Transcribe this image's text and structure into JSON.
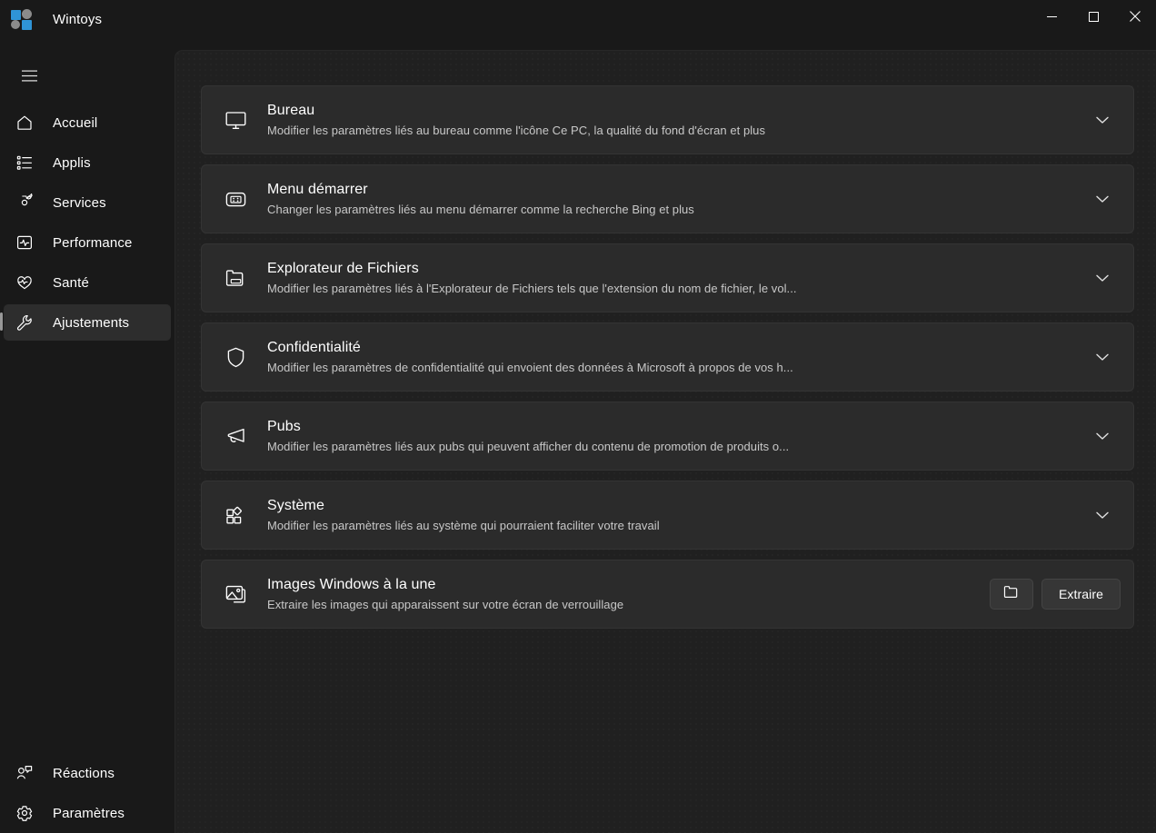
{
  "window": {
    "app_title": "Wintoys",
    "controls": {
      "minimize_label": "Minimize",
      "maximize_label": "Maximize",
      "close_label": "Close"
    }
  },
  "sidebar": {
    "menu_button_label": "Navigation",
    "items": [
      {
        "label": "Accueil",
        "icon": "home-icon",
        "active": false
      },
      {
        "label": "Applis",
        "icon": "apps-list-icon",
        "active": false
      },
      {
        "label": "Services",
        "icon": "gear-cog-icon",
        "active": false
      },
      {
        "label": "Performance",
        "icon": "pulse-chart-icon",
        "active": false
      },
      {
        "label": "Santé",
        "icon": "heart-pulse-icon",
        "active": false
      },
      {
        "label": "Ajustements",
        "icon": "wrench-icon",
        "active": true
      }
    ],
    "bottom_items": [
      {
        "label": "Réactions",
        "icon": "feedback-icon"
      },
      {
        "label": "Paramètres",
        "icon": "settings-gear-icon"
      }
    ]
  },
  "main": {
    "cards": [
      {
        "title": "Bureau",
        "description": "Modifier les paramètres liés au bureau comme l'icône Ce PC, la qualité du fond d'écran et plus",
        "icon": "monitor-icon",
        "expander": "chevron-down-icon"
      },
      {
        "title": "Menu démarrer",
        "description": "Changer les paramètres liés au menu démarrer comme la recherche Bing et plus",
        "icon": "start-menu-icon",
        "expander": "chevron-down-icon"
      },
      {
        "title": "Explorateur de Fichiers",
        "description": "Modifier les paramètres liés à l'Explorateur de Fichiers tels que l'extension du nom de fichier, le vol...",
        "icon": "folder-icon",
        "expander": "chevron-down-icon"
      },
      {
        "title": "Confidentialité",
        "description": "Modifier les paramètres de confidentialité qui envoient des données à Microsoft à propos de vos h...",
        "icon": "shield-icon",
        "expander": "chevron-down-icon"
      },
      {
        "title": "Pubs",
        "description": "Modifier les paramètres liés aux pubs qui peuvent afficher du contenu de promotion de produits o...",
        "icon": "megaphone-icon",
        "expander": "chevron-down-icon"
      },
      {
        "title": "Système",
        "description": "Modifier les paramètres liés au système qui pourraient faciliter votre travail",
        "icon": "system-grid-icon",
        "expander": "chevron-down-icon"
      }
    ],
    "spotlight_card": {
      "title": "Images Windows à la une",
      "description": "Extraire les images qui apparaissent sur votre écran de verrouillage",
      "icon": "picture-icon",
      "folder_button_icon": "folder-open-icon",
      "extract_button_label": "Extraire"
    }
  },
  "colors": {
    "window_background": "#191919",
    "content_background": "#202020",
    "card_background": "#2b2b2b",
    "button_background": "#363636",
    "active_nav_background": "#2d2d2d",
    "accent_logo_blue": "#2f94d6",
    "text_primary": "#ffffff",
    "text_secondary": "#c8c8c8"
  }
}
